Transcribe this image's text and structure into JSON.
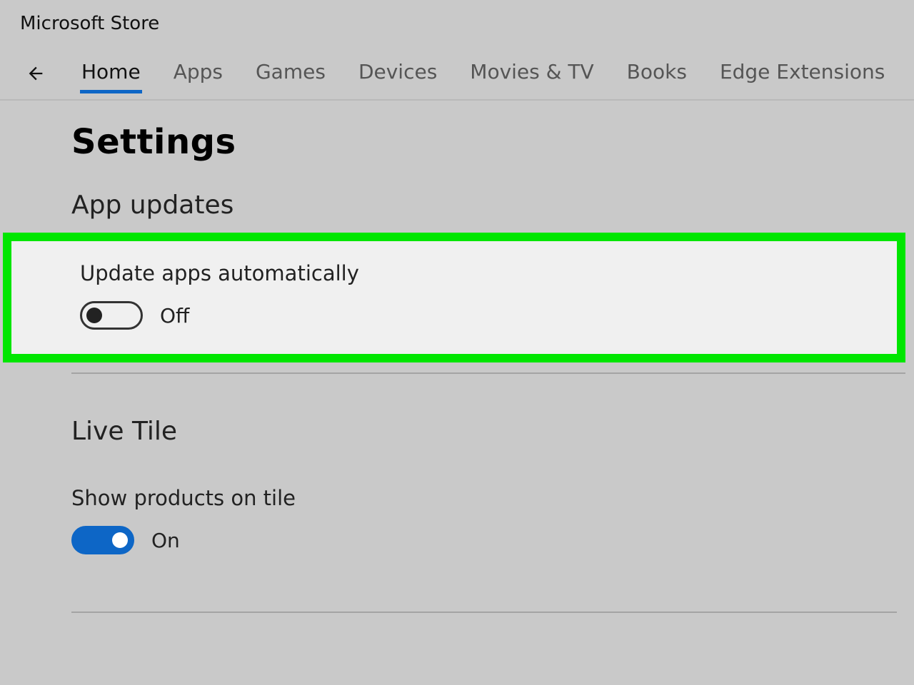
{
  "app_title": "Microsoft Store",
  "nav": {
    "items": [
      {
        "label": "Home",
        "active": true
      },
      {
        "label": "Apps",
        "active": false
      },
      {
        "label": "Games",
        "active": false
      },
      {
        "label": "Devices",
        "active": false
      },
      {
        "label": "Movies & TV",
        "active": false
      },
      {
        "label": "Books",
        "active": false
      },
      {
        "label": "Edge Extensions",
        "active": false
      }
    ]
  },
  "page": {
    "title": "Settings",
    "section1": {
      "header": "App updates",
      "setting_label": "Update apps automatically",
      "toggle_state": "Off",
      "highlighted": true
    },
    "section2": {
      "header": "Live Tile",
      "setting_label": "Show products on tile",
      "toggle_state": "On"
    }
  },
  "colors": {
    "accent": "#0d66c6",
    "highlight_border": "#00e600"
  }
}
